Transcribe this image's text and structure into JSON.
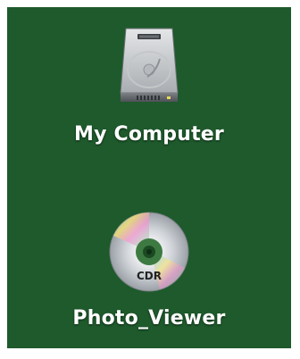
{
  "desktop": {
    "background_color": "#1e5a2c",
    "icons": [
      {
        "label": "My Computer",
        "icon": "hard-drive-icon"
      },
      {
        "label": "Photo_Viewer",
        "icon": "cd-disc-icon",
        "disc_label": "CDR"
      }
    ]
  }
}
